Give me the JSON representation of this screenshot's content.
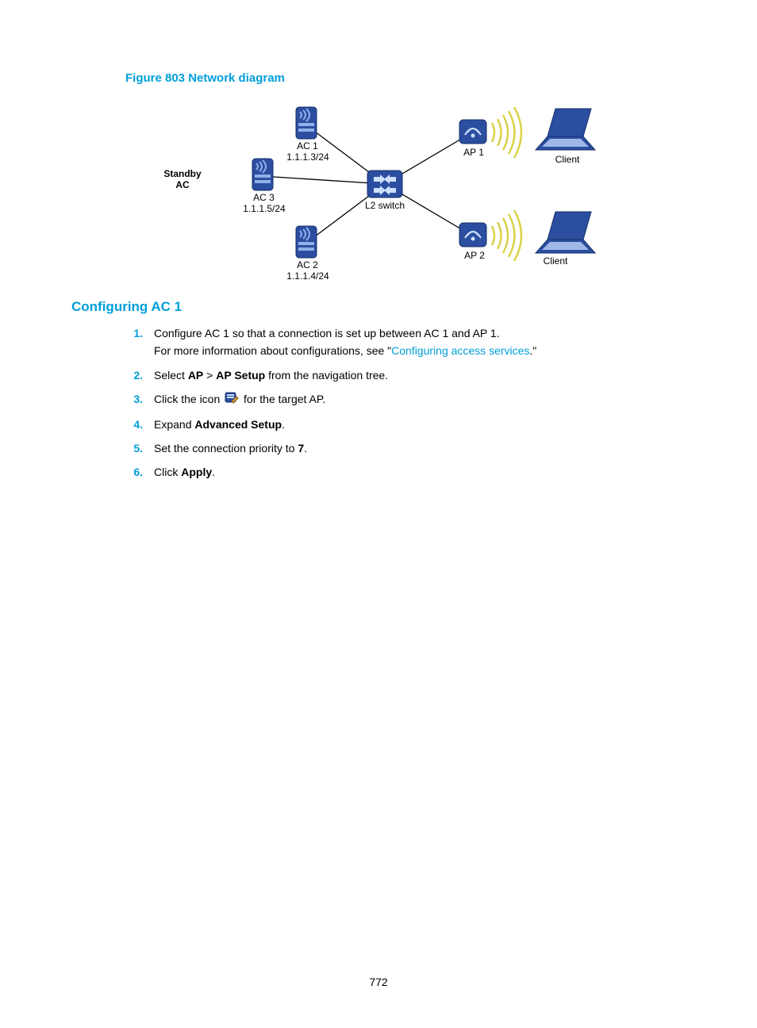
{
  "figure_caption": "Figure 803 Network diagram",
  "diagram": {
    "standby_label": "Standby\nAC",
    "ac1": {
      "name": "AC 1",
      "ip": "1.1.1.3/24"
    },
    "ac2": {
      "name": "AC 2",
      "ip": "1.1.1.4/24"
    },
    "ac3": {
      "name": "AC 3",
      "ip": "1.1.1.5/24"
    },
    "switch_label": "L2 switch",
    "ap1": "AP 1",
    "ap2": "AP 2",
    "client1": "Client",
    "client2": "Client"
  },
  "section_heading": "Configuring AC 1",
  "steps": [
    {
      "num": "1.",
      "lines": [
        [
          {
            "t": "Configure AC 1 so that a connection is set up between AC 1 and AP 1."
          }
        ],
        [
          {
            "t": "For more information about configurations, see \""
          },
          {
            "t": "Configuring access services",
            "link": true
          },
          {
            "t": ".\""
          }
        ]
      ]
    },
    {
      "num": "2.",
      "lines": [
        [
          {
            "t": "Select "
          },
          {
            "t": "AP",
            "bold": true
          },
          {
            "t": " > "
          },
          {
            "t": "AP Setup",
            "bold": true
          },
          {
            "t": " from the navigation tree."
          }
        ]
      ]
    },
    {
      "num": "3.",
      "lines": [
        [
          {
            "t": "Click the icon "
          },
          {
            "icon": "edit"
          },
          {
            "t": " for the target AP."
          }
        ]
      ]
    },
    {
      "num": "4.",
      "lines": [
        [
          {
            "t": "Expand "
          },
          {
            "t": "Advanced Setup",
            "bold": true
          },
          {
            "t": "."
          }
        ]
      ]
    },
    {
      "num": "5.",
      "lines": [
        [
          {
            "t": "Set the connection priority to "
          },
          {
            "t": "7",
            "bold": true
          },
          {
            "t": "."
          }
        ]
      ]
    },
    {
      "num": "6.",
      "lines": [
        [
          {
            "t": "Click "
          },
          {
            "t": "Apply",
            "bold": true
          },
          {
            "t": "."
          }
        ]
      ]
    }
  ],
  "page_number": "772"
}
